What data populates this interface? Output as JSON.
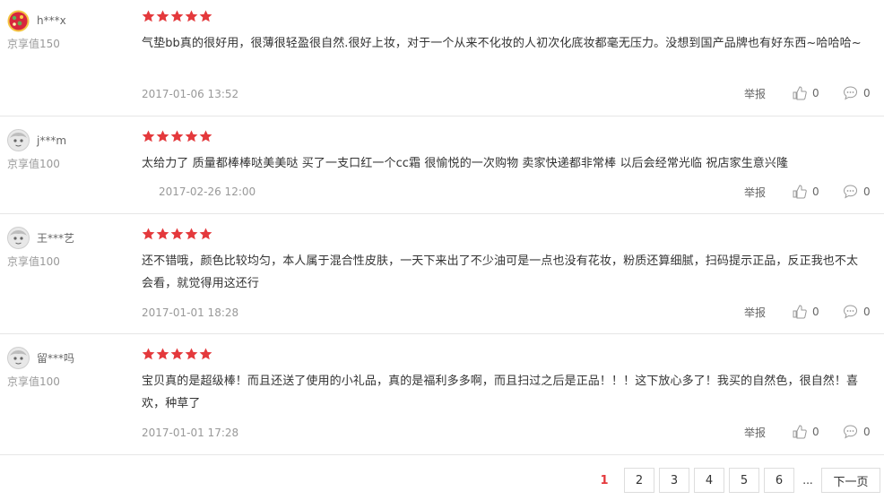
{
  "reviews": [
    {
      "username": "h***x",
      "level": "京享值150",
      "text": "气垫bb真的很好用，很薄很轻盈很自然.很好上妆，对于一个从来不化妆的人初次化底妆都毫无压力。没想到国产品牌也有好东西~哈哈哈~",
      "date": "2017-01-06 13:52",
      "report": "举报",
      "likes": "0",
      "replies": "0",
      "rating": 5,
      "avatar": "fruit-avatar"
    },
    {
      "username": "j***m",
      "level": "京享值100",
      "text": "太给力了 质量都棒棒哒美美哒 买了一支口红一个cc霜 很愉悦的一次购物 卖家快递都非常棒 以后会经常光临 祝店家生意兴隆",
      "date": "2017-02-26 12:00",
      "report": "举报",
      "likes": "0",
      "replies": "0",
      "rating": 5,
      "avatar": "default-avatar"
    },
    {
      "username": "王***艺",
      "level": "京享值100",
      "text": "还不错哦，颜色比较均匀，本人属于混合性皮肤，一天下来出了不少油可是一点也没有花妆，粉质还算细腻，扫码提示正品，反正我也不太会看，就觉得用这还行",
      "date": "2017-01-01 18:28",
      "report": "举报",
      "likes": "0",
      "replies": "0",
      "rating": 5,
      "avatar": "default-avatar"
    },
    {
      "username": "留***吗",
      "level": "京享值100",
      "text": "宝贝真的是超级棒！而且还送了使用的小礼品，真的是福利多多啊，而且扫过之后是正品！！！这下放心多了！我买的自然色，很自然！喜欢，种草了",
      "date": "2017-01-01 17:28",
      "report": "举报",
      "likes": "0",
      "replies": "0",
      "rating": 5,
      "avatar": "default-avatar"
    }
  ],
  "pagination": {
    "pages": [
      "1",
      "2",
      "3",
      "4",
      "5",
      "6"
    ],
    "current": "1",
    "ellipsis": "...",
    "next": "下一页"
  },
  "colors": {
    "star": "#e4393c",
    "current_page": "#e4393c",
    "muted": "#999999"
  }
}
